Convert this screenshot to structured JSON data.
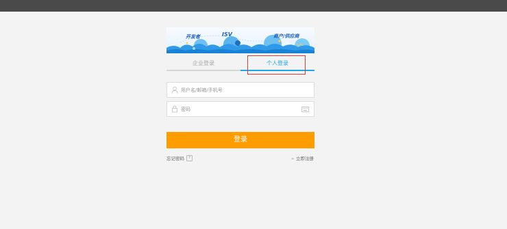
{
  "banner": {
    "label_developer": "开发者",
    "label_isv": "ISV",
    "label_merchant": "商户/供应商"
  },
  "tabs": {
    "company": "企业登录",
    "personal": "个人登录",
    "active": "personal"
  },
  "form": {
    "username_placeholder": "用户名/邮箱/手机号",
    "username_value": "",
    "password_placeholder": "密码",
    "password_value": "",
    "submit_label": "登录"
  },
  "links": {
    "forgot": "忘记密码",
    "forgot_help": "?",
    "register_arrow": "»",
    "register": "立即注册"
  },
  "colors": {
    "topbar": "#4a4a4a",
    "background": "#f3f3f3",
    "accent_blue": "#1da6e6",
    "button_orange": "#ff9c00",
    "annotation_red": "#e53935"
  },
  "icons": {
    "username": "user-icon",
    "password": "lock-icon",
    "keyboard": "keyboard-icon"
  }
}
